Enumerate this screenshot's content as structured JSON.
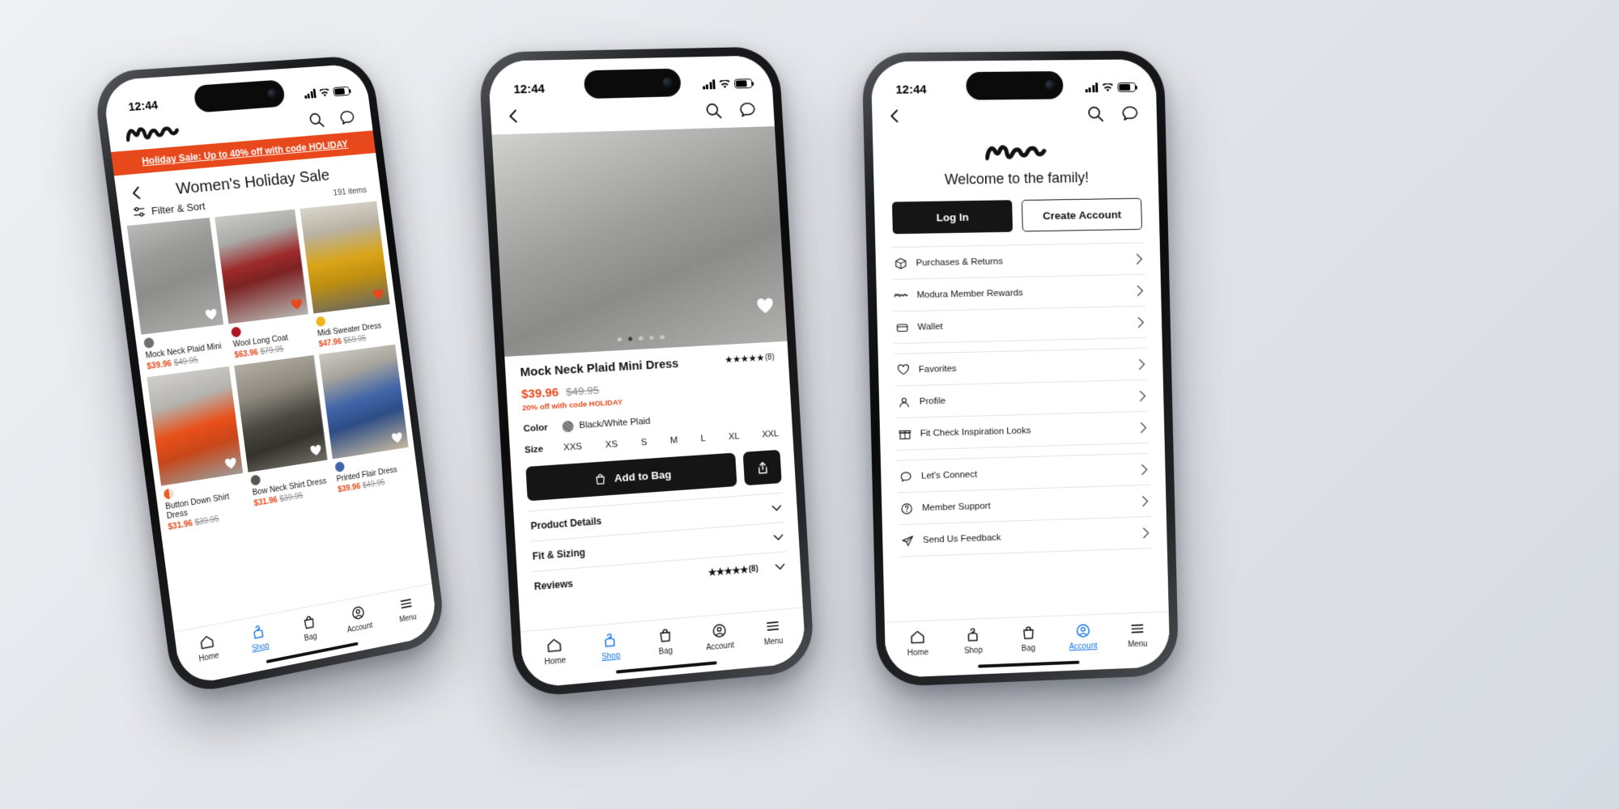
{
  "brand": {
    "name": "Modura",
    "logo_icon": "modura-wave-logo"
  },
  "colors": {
    "accent_orange": "#E8491C",
    "active_blue": "#1473E6",
    "dark_button": "#151515"
  },
  "status_bar": {
    "time": "12:44",
    "signal_icon": "cellular-bars-icon",
    "wifi_icon": "wifi-icon",
    "battery_icon": "battery-icon"
  },
  "tabbar": {
    "items": [
      {
        "label": "Home",
        "icon": "home-icon",
        "active": false
      },
      {
        "label": "Shop",
        "icon": "hanger-icon",
        "active": true
      },
      {
        "label": "Bag",
        "icon": "bag-icon",
        "active": false
      },
      {
        "label": "Account",
        "icon": "person-circle-icon",
        "active": false
      },
      {
        "label": "Menu",
        "icon": "hamburger-icon",
        "active": false
      }
    ],
    "account_active": [
      {
        "label": "Home",
        "icon": "home-icon",
        "active": false
      },
      {
        "label": "Shop",
        "icon": "hanger-icon",
        "active": false
      },
      {
        "label": "Bag",
        "icon": "bag-icon",
        "active": false
      },
      {
        "label": "Account",
        "icon": "person-circle-icon",
        "active": true
      },
      {
        "label": "Menu",
        "icon": "hamburger-icon",
        "active": false
      }
    ]
  },
  "phone1": {
    "appbar": {
      "search_icon": "search-icon",
      "chat_icon": "chat-bubble-icon"
    },
    "promo": "Holiday Sale: Up to 40% off with code HOLIDAY",
    "page_title": "Women's Holiday Sale",
    "back_icon": "chevron-left-icon",
    "filter_label": "Filter & Sort",
    "filter_icon": "filter-sliders-icon",
    "item_count": "191 items",
    "products": [
      {
        "name": "Mock Neck Plaid Mini",
        "sale": "$39.96",
        "was": "$49.95",
        "swatch": "#6f6f6f",
        "favorited": false,
        "photo": "ph-grey"
      },
      {
        "name": "Wool Long Coat",
        "sale": "$63.96",
        "was": "$79.95",
        "swatch": "#B01524",
        "favorited": true,
        "photo": "ph-red"
      },
      {
        "name": "Midi Sweater Dress",
        "sale": "$47.96",
        "was": "$59.95",
        "swatch": "#F0B41C",
        "favorited": true,
        "photo": "ph-yellow"
      },
      {
        "name": "Button Down Shirt Dress",
        "sale": "$31.96",
        "was": "$39.95",
        "swatch": "split",
        "favorited": false,
        "photo": "ph-orange"
      },
      {
        "name": "Bow Neck Shirt Dress",
        "sale": "$31.96",
        "was": "$39.95",
        "swatch": "#4E5A4C",
        "favorited": false,
        "photo": "ph-dark"
      },
      {
        "name": "Printed Flair Dress",
        "sale": "$39.96",
        "was": "$49.95",
        "swatch": "#3F64A8",
        "favorited": false,
        "photo": "ph-blue"
      }
    ]
  },
  "phone2": {
    "back_icon": "chevron-left-icon",
    "search_icon": "search-icon",
    "chat_icon": "chat-bubble-icon",
    "hero_photo": "ph-hero",
    "favorite_icon": "heart-outline-icon",
    "carousel": {
      "total_dots": 5,
      "active_index": 1,
      "next_arrow": "chevron-right-icon"
    },
    "title": "Mock Neck Plaid Mini Dress",
    "rating": {
      "stars": "★★★★★",
      "count": "(8)"
    },
    "price_sale": "$39.96",
    "price_was": "$49.95",
    "promo": "20% off with code HOLIDAY",
    "color_label": "Color",
    "color_value": "Black/White Plaid",
    "size_label": "Size",
    "sizes": [
      "XXS",
      "XS",
      "S",
      "M",
      "L",
      "XL",
      "XXL"
    ],
    "add_to_bag": "Add to Bag",
    "bag_icon": "bag-icon",
    "share_icon": "share-icon",
    "accordions": [
      {
        "label": "Product Details",
        "icon": "chevron-down-icon"
      },
      {
        "label": "Fit & Sizing",
        "icon": "chevron-down-icon"
      },
      {
        "label": "Reviews",
        "icon": "chevron-down-icon"
      }
    ],
    "reviews_stars": "★★★★★",
    "reviews_count": "(8)"
  },
  "phone3": {
    "back_icon": "chevron-left-icon",
    "search_icon": "search-icon",
    "chat_icon": "chat-bubble-icon",
    "logo_icon": "modura-wave-logo",
    "welcome": "Welcome to the family!",
    "login_label": "Log In",
    "create_label": "Create Account",
    "menu_group_1": [
      {
        "label": "Purchases & Returns",
        "icon": "package-icon"
      },
      {
        "label": "Modura Member Rewards",
        "icon": "modura-wave-logo"
      },
      {
        "label": "Wallet",
        "icon": "wallet-icon"
      }
    ],
    "menu_group_2": [
      {
        "label": "Favorites",
        "icon": "heart-outline-icon"
      },
      {
        "label": "Profile",
        "icon": "person-icon"
      },
      {
        "label": "Fit Check Inspiration Looks",
        "icon": "gift-icon"
      }
    ],
    "menu_group_3": [
      {
        "label": "Let's Connect",
        "icon": "chat-bubble-icon"
      },
      {
        "label": "Member Support",
        "icon": "question-circle-icon"
      },
      {
        "label": "Send Us Feedback",
        "icon": "paper-plane-icon"
      }
    ],
    "chevron_icon": "chevron-right-icon"
  }
}
